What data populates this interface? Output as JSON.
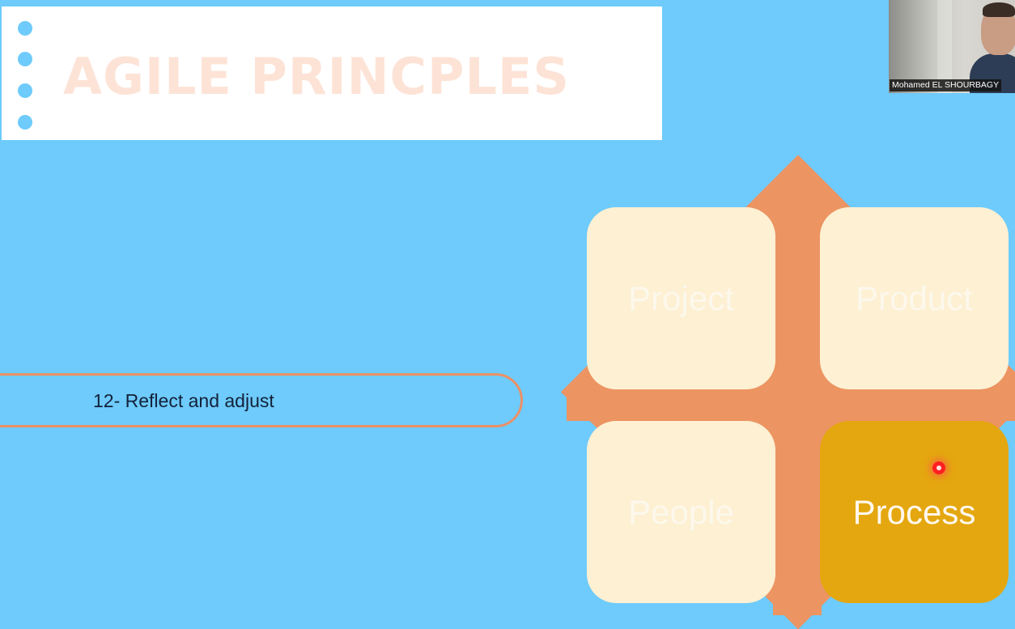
{
  "slide": {
    "title": "AGILE PRINCPLES",
    "principle_text": "12- Reflect and adjust",
    "quadrants": [
      {
        "label": "Project",
        "active": false
      },
      {
        "label": "Product",
        "active": false
      },
      {
        "label": "People",
        "active": false
      },
      {
        "label": "Process",
        "active": true
      }
    ]
  },
  "webcam": {
    "participant_name": "Mohamed EL SHOURBAGY"
  },
  "colors": {
    "background": "#6ecbfb",
    "accent_orange": "#ec9462",
    "tile_cream": "#fdf0d3",
    "active_gold": "#e4a70f",
    "title_faded": "#fde3d6"
  },
  "icons": [
    "bullet-dot",
    "laser-pointer-icon"
  ]
}
